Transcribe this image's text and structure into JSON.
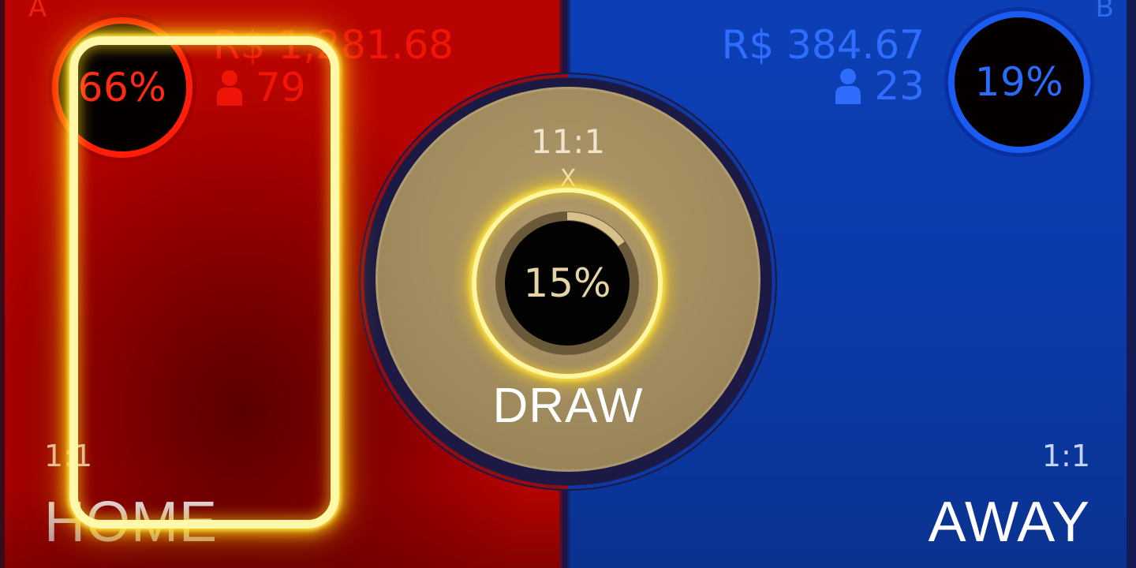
{
  "home": {
    "corner_letter": "A",
    "percent": "66%",
    "amount": "R$ 1,281.68",
    "players": "79",
    "payout": "1:1",
    "label": "HOME",
    "color": "#ff1e0a"
  },
  "away": {
    "corner_letter": "B",
    "percent": "19%",
    "amount": "R$ 384.67",
    "players": "23",
    "payout": "1:1",
    "label": "AWAY",
    "color": "#1a5cf0"
  },
  "draw": {
    "payout": "11:1",
    "multiplier_symbol": "X",
    "percent": "15%",
    "progress_fraction": 0.15,
    "label": "DRAW",
    "color": "#a08b5e"
  },
  "highlight_color": "#ffe640",
  "icons": {
    "players": "person-icon"
  }
}
